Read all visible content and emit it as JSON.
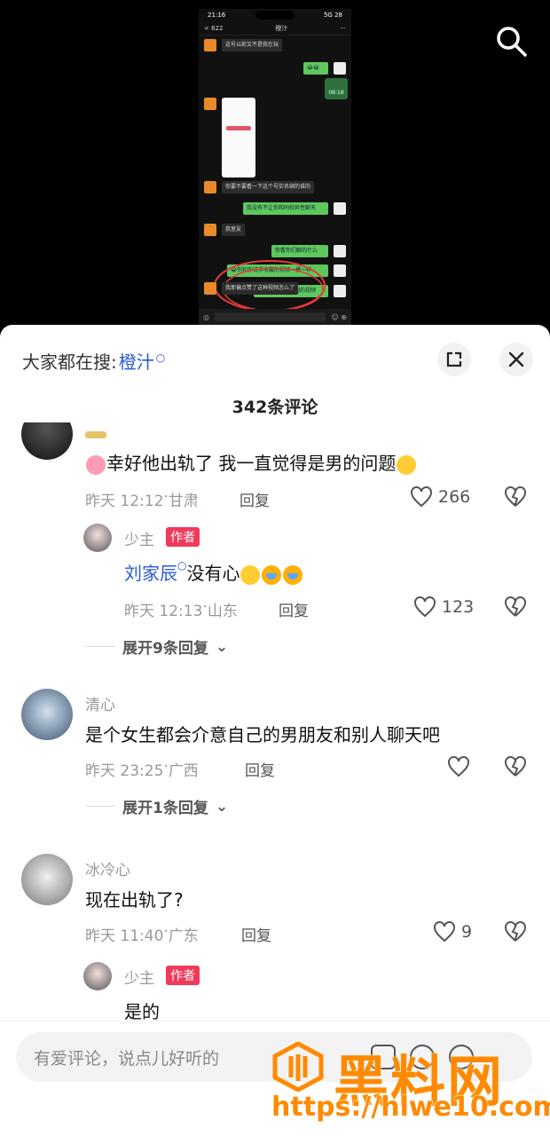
{
  "video": {
    "status_time": "21:16",
    "status_right": "5G 28",
    "chat_back": "< 622",
    "chat_title": "橙汁",
    "messages": [
      {
        "side": "left",
        "text": "这号以前又不是我在玩"
      },
      {
        "side": "right",
        "text": "😂😂"
      },
      {
        "side": "right",
        "text": "08:18"
      },
      {
        "side": "left",
        "text": "你要不要看一下这个号实名绑的谁的"
      },
      {
        "side": "right",
        "text": "我没有不让你和同校异性聊天"
      },
      {
        "side": "left",
        "text": "我室友"
      },
      {
        "side": "right",
        "text": "你看你们聊的什么"
      },
      {
        "side": "right",
        "text": "😂你和你说手收藏的视频一模一样"
      },
      {
        "side": "right",
        "text": "我看得你可以刷到的视频"
      },
      {
        "side": "left",
        "text": "我那偏点赞了这种视频怎么了"
      }
    ]
  },
  "sheet": {
    "search_label": "大家都在搜:",
    "search_keyword": "橙汁",
    "comment_count": "342条评论"
  },
  "comments": [
    {
      "name": "",
      "text": "幸好他出轨了 我一直觉得是男的问题",
      "time": "昨天 12:12",
      "location": "甘肃",
      "reply": "回复",
      "likes": "266"
    },
    {
      "name": "少主",
      "badge": "作者",
      "mention": "刘家辰",
      "text": "没有心",
      "time": "昨天 12:13",
      "location": "山东",
      "reply": "回复",
      "likes": "123",
      "expand": "展开9条回复"
    },
    {
      "name": "清心",
      "text": "是个女生都会介意自己的男朋友和别人聊天吧",
      "time": "昨天 23:25",
      "location": "广西",
      "reply": "回复",
      "likes": "",
      "expand": "展开1条回复"
    },
    {
      "name": "冰冷心",
      "text": "现在出轨了?",
      "time": "昨天 11:40",
      "location": "广东",
      "reply": "回复",
      "likes": "9"
    },
    {
      "name": "少主",
      "badge": "作者",
      "text": "是的"
    }
  ],
  "input": {
    "placeholder": "有爱评论，说点儿好听的"
  },
  "watermark": {
    "text": "黑料网",
    "url": "https://hlwe10.com"
  },
  "colors": {
    "mention": "#2a5bd7",
    "badge": "#f03a5b",
    "chat_green": "#5ec75e"
  }
}
